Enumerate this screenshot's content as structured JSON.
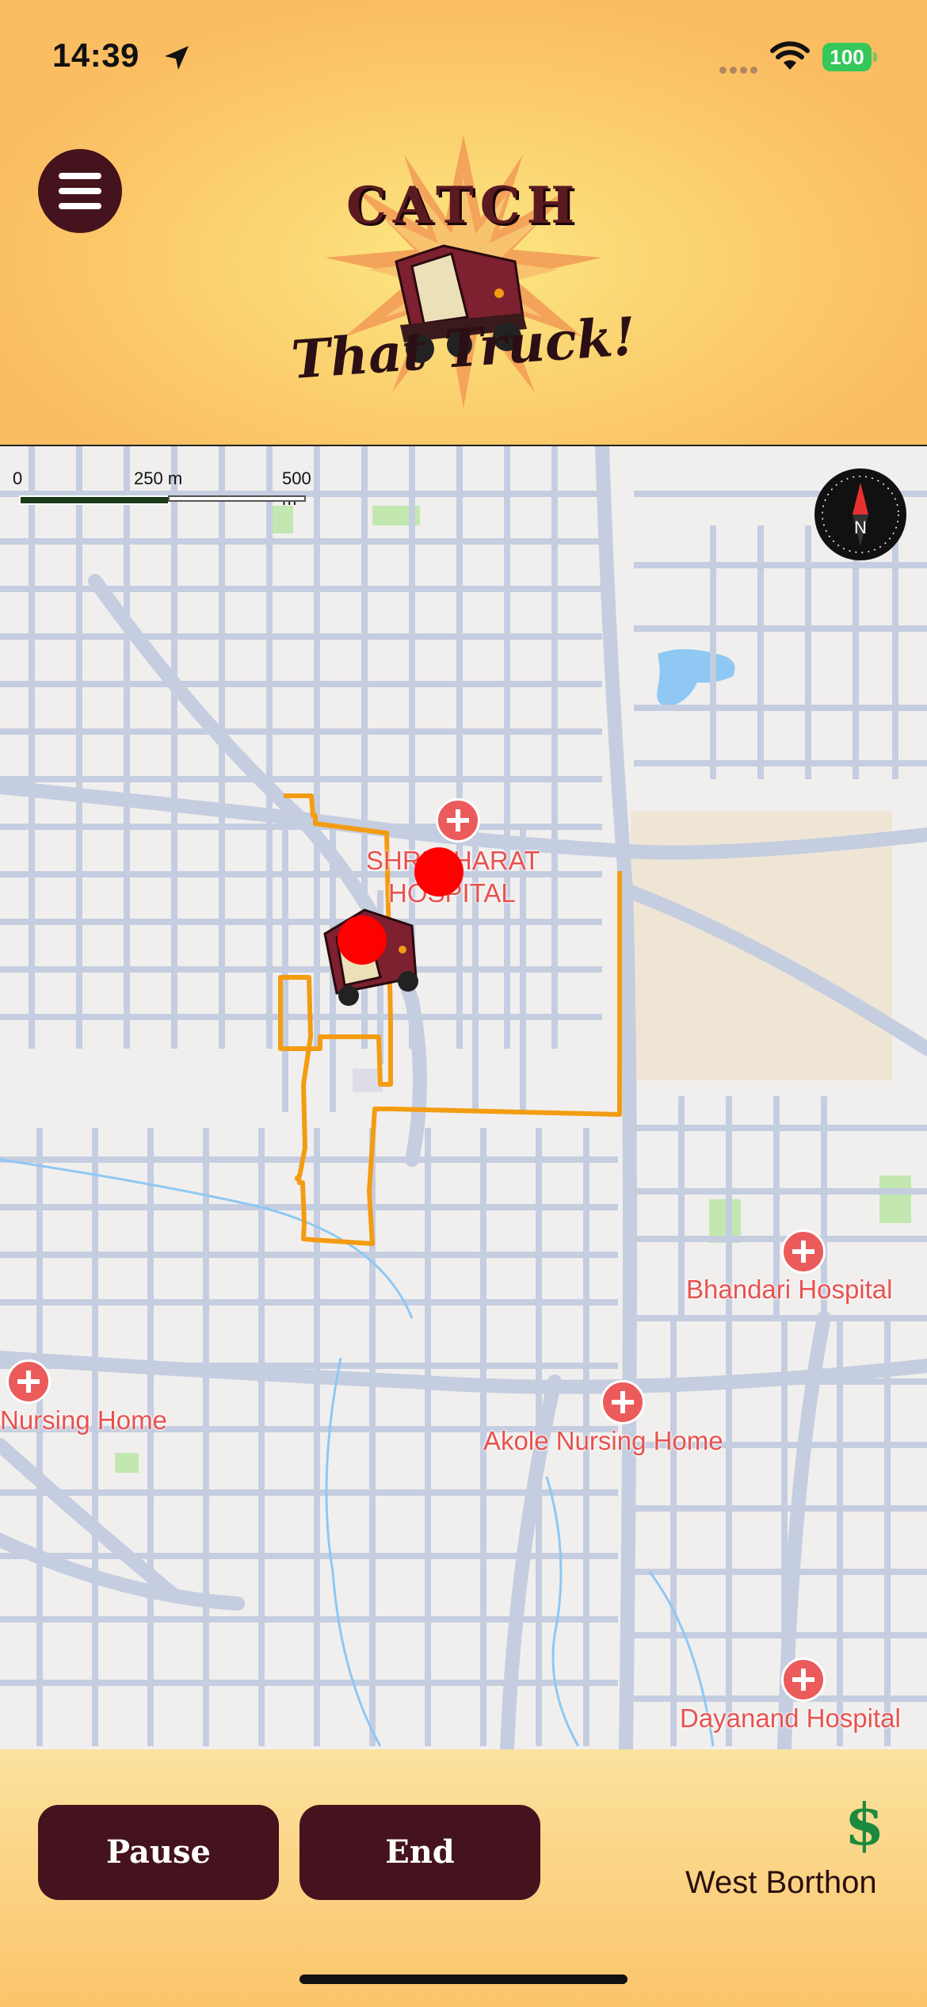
{
  "status_bar": {
    "time": "14:39",
    "battery": "100",
    "location_icon": "location-arrow-icon",
    "wifi_icon": "wifi-icon"
  },
  "header": {
    "menu_icon": "hamburger-menu-icon",
    "logo": {
      "line1": "CATCH",
      "line2": "That Truck!",
      "icon": "auto-rickshaw-logo"
    }
  },
  "map": {
    "scale": {
      "labels": [
        "0",
        "250 m",
        "500 m"
      ]
    },
    "compass": {
      "label": "N"
    },
    "pois": [
      {
        "name_line1": "SHRI BHARAT",
        "name_line2": "HOSPITAL"
      },
      {
        "name": "Bhandari Hospital"
      },
      {
        "name": "Nursing Home"
      },
      {
        "name": "Akole Nursing Home"
      },
      {
        "name": "Dayanand Hospital"
      }
    ],
    "colors": {
      "route": "#f39c12",
      "road": "#c5cde0",
      "water": "#8ec8f3",
      "park": "#c2e8b0",
      "poi": "#e8524f",
      "marker": "#ff0000"
    }
  },
  "footer": {
    "pause_label": "Pause",
    "end_label": "End",
    "currency_symbol": "$",
    "location_name": "West Borthon"
  },
  "colors": {
    "accent": "#45131d",
    "header_light": "#fbe882",
    "header_dark": "#fbbd62"
  }
}
